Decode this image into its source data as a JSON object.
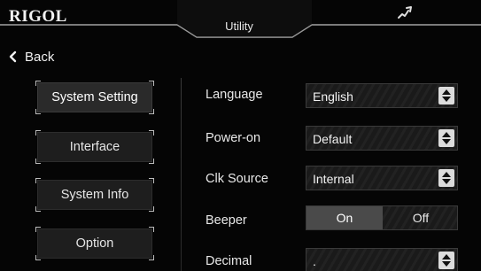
{
  "header": {
    "logo": "RIGOL",
    "title": "Utility",
    "status_icon": "signal-icon"
  },
  "nav": {
    "back_label": "Back",
    "back_icon": "chevron-left-icon"
  },
  "menu": {
    "items": [
      {
        "label": "System Setting",
        "active": true
      },
      {
        "label": "Interface",
        "active": false
      },
      {
        "label": "System Info",
        "active": false
      },
      {
        "label": "Option",
        "active": false
      }
    ]
  },
  "settings": {
    "language": {
      "label": "Language",
      "value": "English"
    },
    "power_on": {
      "label": "Power-on",
      "value": "Default"
    },
    "clk_source": {
      "label": "Clk Source",
      "value": "Internal"
    },
    "beeper": {
      "label": "Beeper",
      "options": [
        "On",
        "Off"
      ],
      "selected": "On"
    },
    "decimal": {
      "label": "Decimal",
      "value": "."
    }
  },
  "colors": {
    "background": "#050505",
    "button": "#1e1e1e",
    "accent_selected": "#4a4a4a",
    "spinner": "#dcdcdc"
  }
}
